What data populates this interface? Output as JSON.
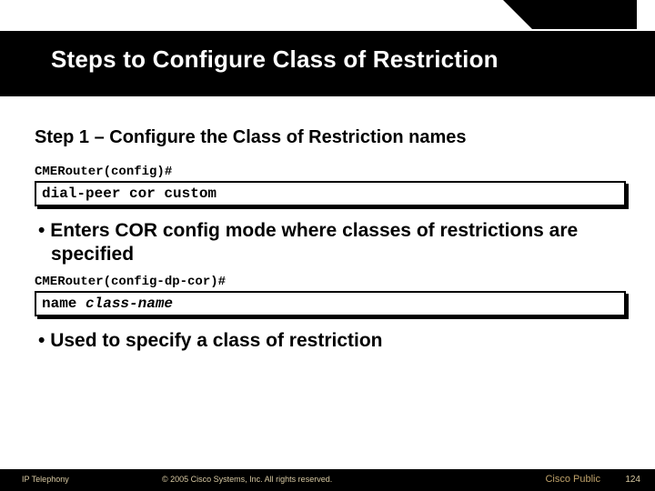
{
  "title": "Steps to Configure Class of Restriction",
  "step_heading": "Step 1 – Configure the Class of Restriction names",
  "prompt1": "CMERouter(config)#",
  "cmd1": "dial-peer cor custom",
  "bullet1": "Enters COR config mode where classes of restrictions are specified",
  "prompt2": "CMERouter(config-dp-cor)#",
  "cmd2_literal": "name ",
  "cmd2_arg": "class-name",
  "bullet2": "Used to specify a class of restriction",
  "footer": {
    "left": "IP Telephony",
    "copyright": "© 2005 Cisco Systems, Inc. All rights reserved.",
    "public": "Cisco Public",
    "page": "124"
  }
}
